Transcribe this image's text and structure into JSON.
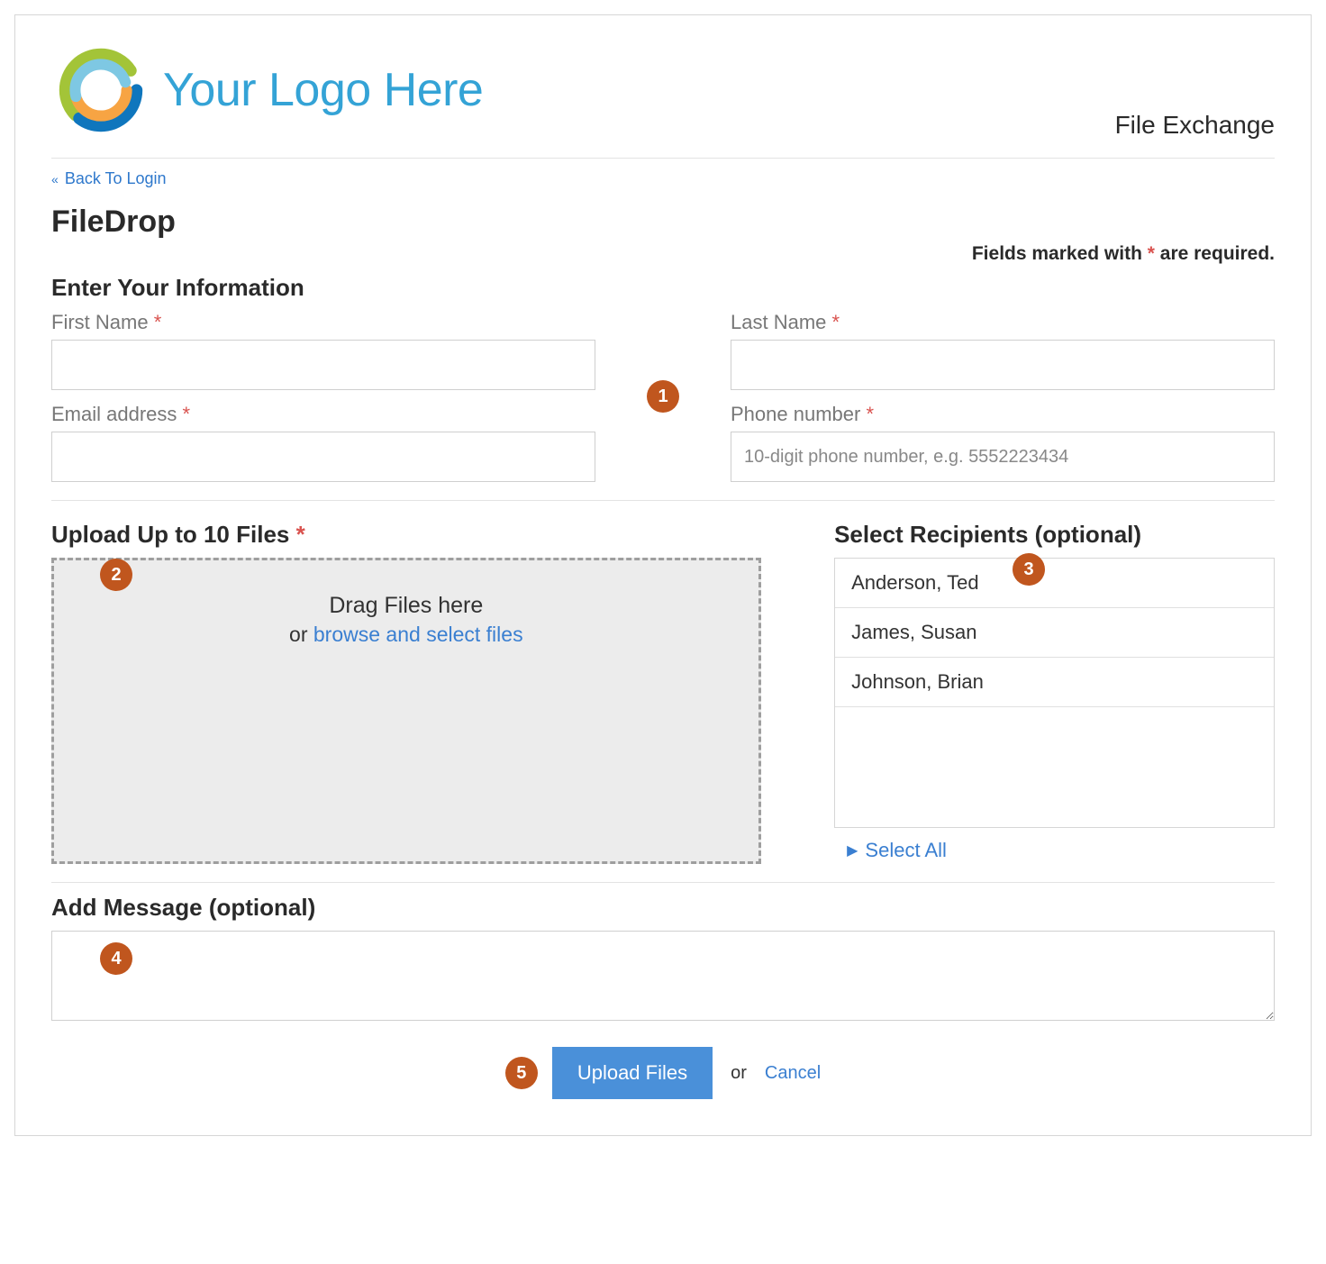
{
  "brand": {
    "text": "Your Logo Here"
  },
  "app_title": "File Exchange",
  "back_link": "Back To Login",
  "page_title": "FileDrop",
  "required_note_prefix": "Fields marked with ",
  "required_note_suffix": " are required.",
  "section_info_title": "Enter Your Information",
  "fields": {
    "first_name_label": "First Name",
    "last_name_label": "Last Name",
    "email_label": "Email address",
    "phone_label": "Phone number",
    "phone_placeholder": "10-digit phone number, e.g. 5552223434"
  },
  "upload": {
    "title": "Upload Up to 10 Files",
    "drag_text": "Drag Files here",
    "or_text": "or ",
    "browse_text": "browse and select files"
  },
  "recipients": {
    "title": "Select Recipients (optional)",
    "items": [
      "Anderson, Ted",
      "James, Susan",
      "Johnson, Brian"
    ],
    "select_all": "Select All"
  },
  "message": {
    "title": "Add Message (optional)"
  },
  "actions": {
    "upload_label": "Upload Files",
    "or_text": "or",
    "cancel_label": "Cancel"
  },
  "badges": {
    "b1": "1",
    "b2": "2",
    "b3": "3",
    "b4": "4",
    "b5": "5"
  },
  "colors": {
    "accent_blue": "#4a90d9",
    "link_blue": "#3a7fd1",
    "badge_orange": "#c0561e",
    "required_red": "#d9534f",
    "logo_blue_dark": "#0f76bd",
    "logo_blue_light": "#7ec8e3",
    "logo_orange": "#f7a443",
    "logo_green": "#a3c438"
  }
}
